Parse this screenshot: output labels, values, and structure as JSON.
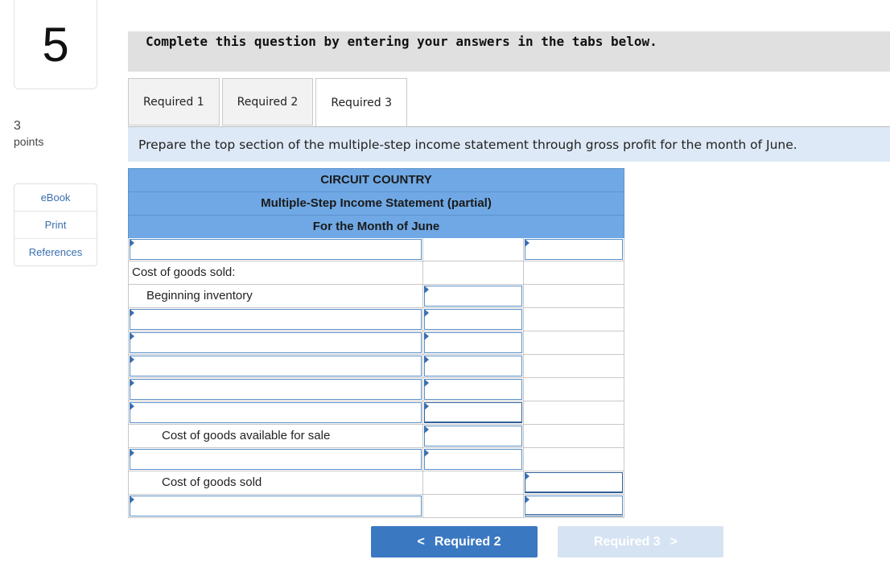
{
  "question": {
    "number": "5",
    "points_value": "3",
    "points_label": "points"
  },
  "side_links": [
    "eBook",
    "Print",
    "References"
  ],
  "banner": "Complete this question by entering your answers in the tabs below.",
  "tabs": [
    {
      "label": "Required 1",
      "active": false
    },
    {
      "label": "Required 2",
      "active": false
    },
    {
      "label": "Required 3",
      "active": true
    }
  ],
  "instruction": "Prepare the top section of the multiple-step income statement through gross profit for the month of June.",
  "statement": {
    "company": "CIRCUIT COUNTRY",
    "title": "Multiple-Step Income Statement (partial)",
    "period": "For the Month of June",
    "rows": [
      {
        "label": "",
        "c1": "input",
        "c2": "none",
        "c3": "input"
      },
      {
        "label": "Cost of goods sold:",
        "c1": "text",
        "c2": "none",
        "c3": "none"
      },
      {
        "label": "Beginning inventory",
        "c1": "text",
        "c2": "input",
        "c3": "none"
      },
      {
        "label": "",
        "c1": "input",
        "c2": "input",
        "c3": "none"
      },
      {
        "label": "",
        "c1": "input",
        "c2": "input",
        "c3": "none"
      },
      {
        "label": "",
        "c1": "input",
        "c2": "input",
        "c3": "none"
      },
      {
        "label": "",
        "c1": "input",
        "c2": "input",
        "c3": "none"
      },
      {
        "label": "",
        "c1": "input",
        "c2": "input-dark",
        "c3": "none"
      },
      {
        "label": "Cost of goods available for sale",
        "c1": "text",
        "c2": "input",
        "c3": "none"
      },
      {
        "label": "",
        "c1": "input",
        "c2": "input",
        "c3": "none"
      },
      {
        "label": "Cost of goods sold",
        "c1": "text",
        "c2": "none",
        "c3": "input-dark"
      },
      {
        "label": "",
        "c1": "input",
        "c2": "none",
        "c3": "input-double"
      }
    ]
  },
  "nav": {
    "prev_label": "Required 2",
    "next_label": "Required 3",
    "prev_chevron": "<",
    "next_chevron": ">"
  }
}
